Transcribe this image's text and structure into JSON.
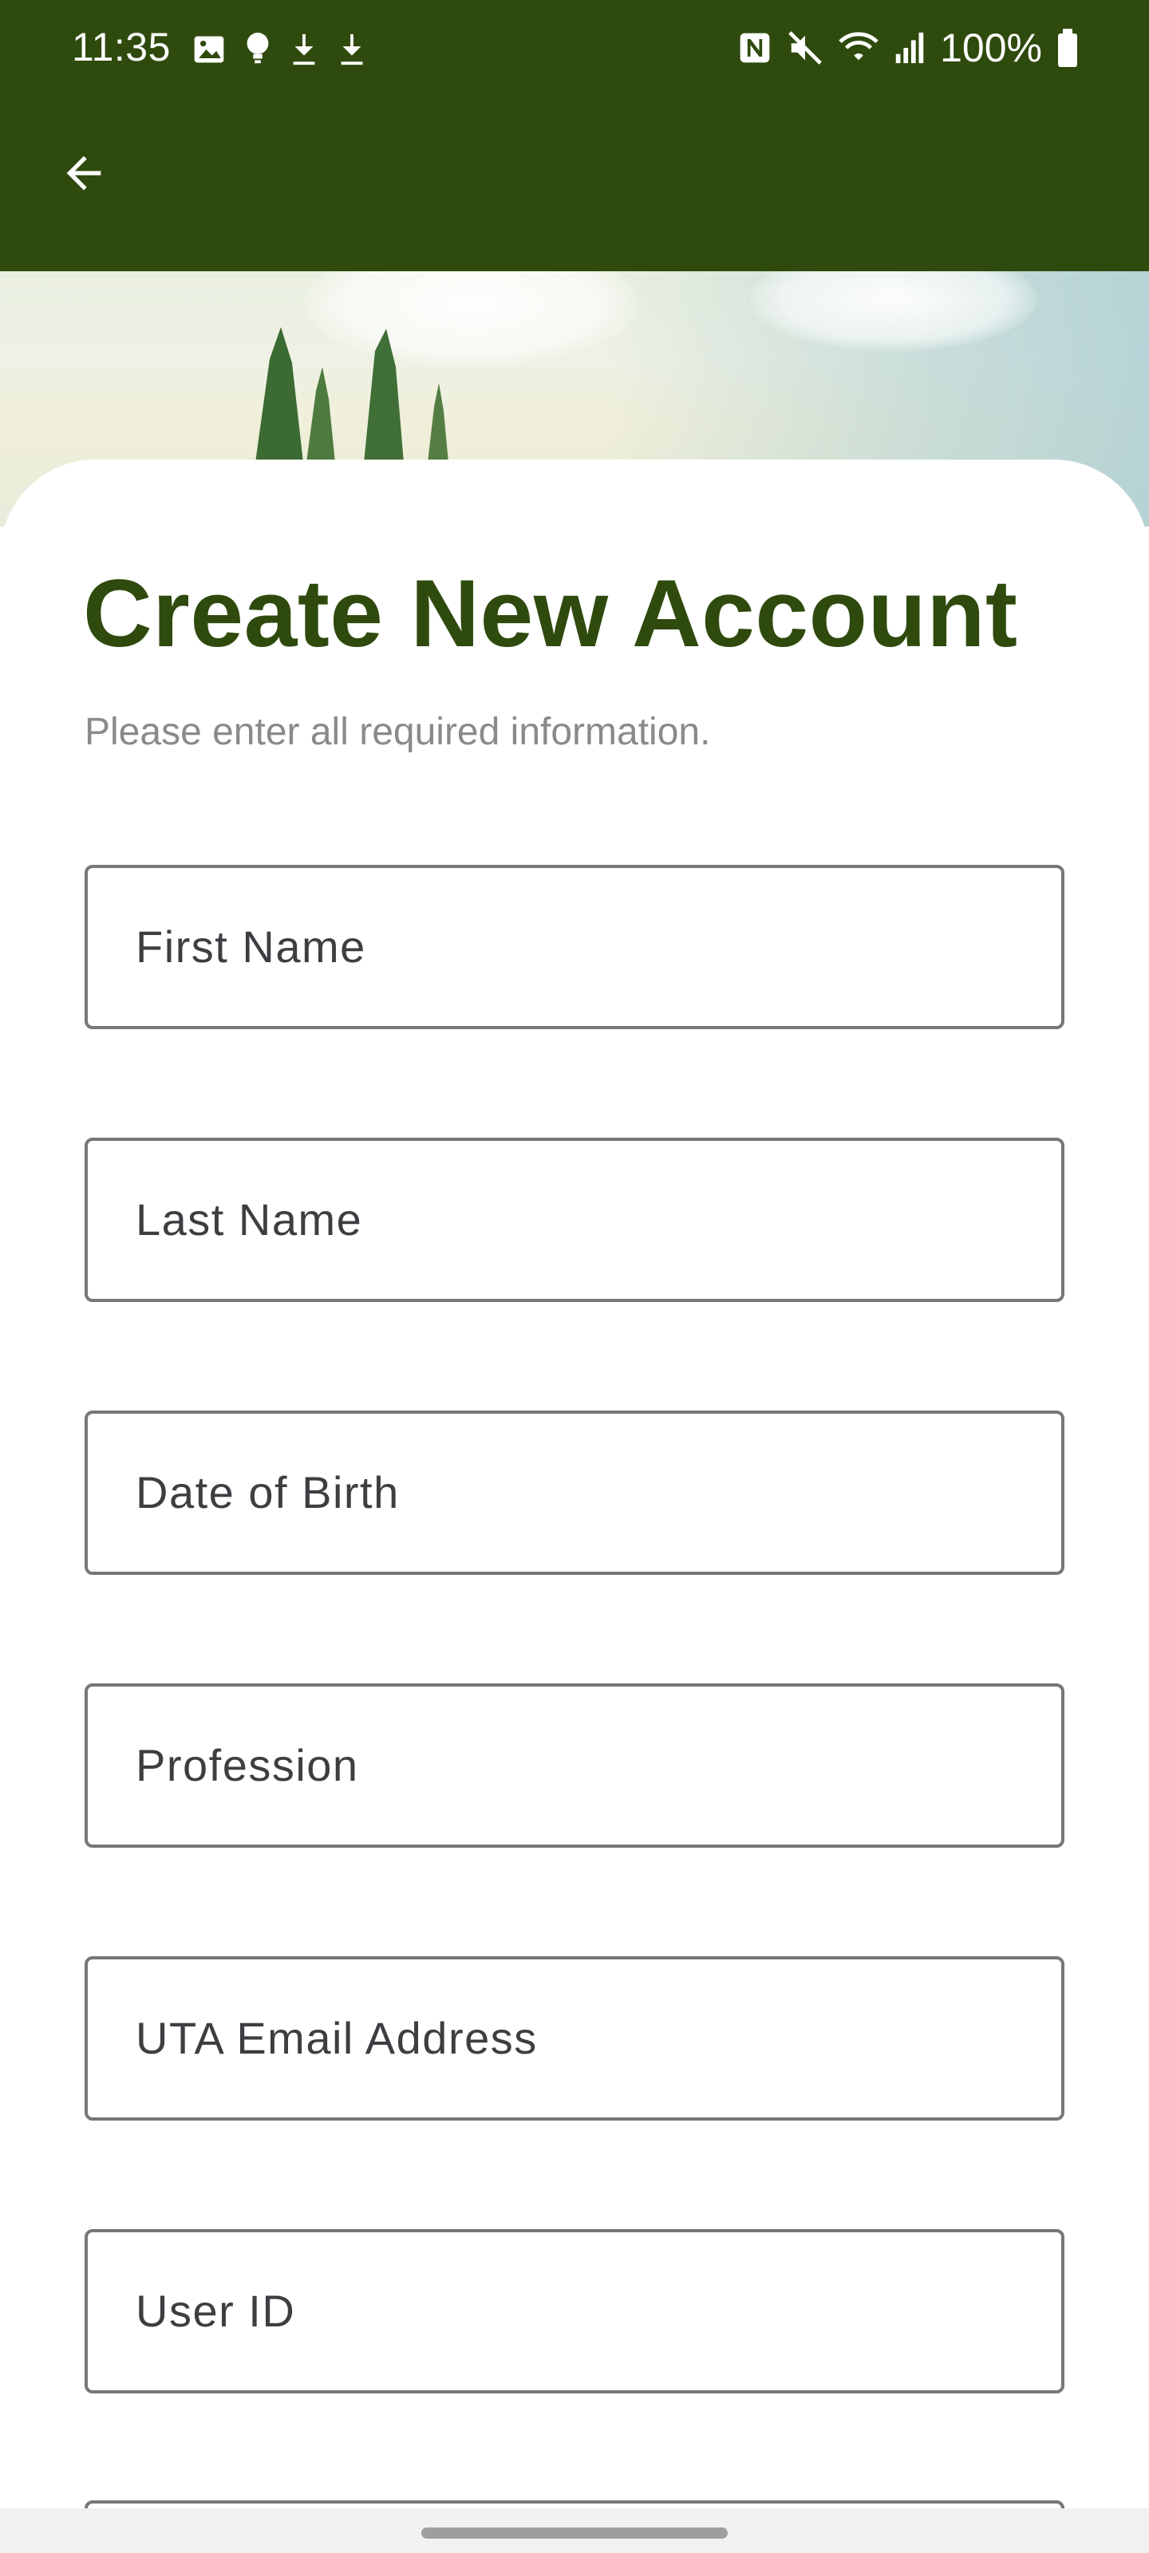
{
  "status_bar": {
    "time": "11:35",
    "battery": "100%",
    "left_icons": [
      "image-icon",
      "lightbulb-icon",
      "download-icon",
      "download-icon"
    ],
    "right_icons": [
      "nfc-icon",
      "mute-icon",
      "wifi-icon",
      "signal-icon",
      "battery-icon"
    ]
  },
  "app_bar": {
    "back_icon": "arrow-left-icon"
  },
  "form": {
    "title": "Create New Account",
    "subtitle": "Please enter all required information.",
    "fields": [
      {
        "label": "First Name"
      },
      {
        "label": "Last Name"
      },
      {
        "label": "Date of Birth"
      },
      {
        "label": "Profession"
      },
      {
        "label": "UTA Email Address"
      },
      {
        "label": "User ID"
      }
    ]
  },
  "colors": {
    "brand_green": "#2f4a0d",
    "field_border": "#79757a",
    "subtitle_gray": "#8a8a8a"
  }
}
